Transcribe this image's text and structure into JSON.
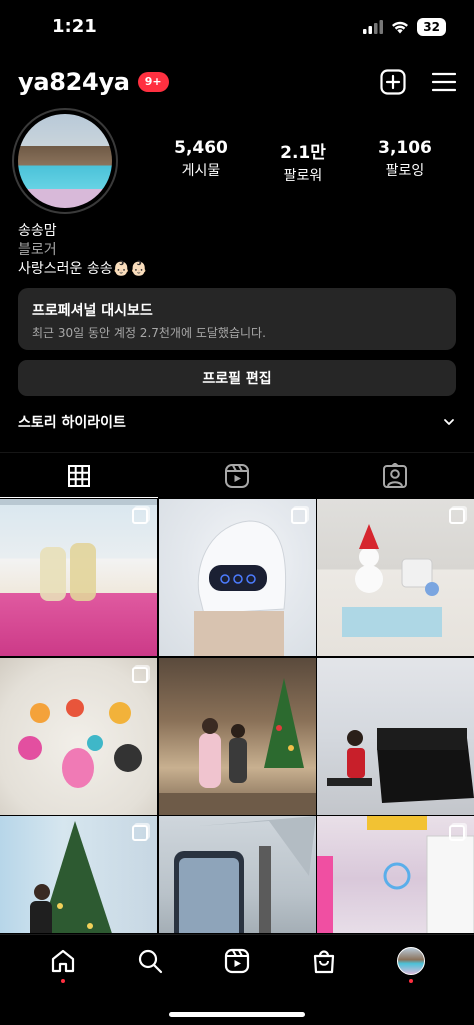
{
  "status_bar": {
    "time": "1:21",
    "battery": "32"
  },
  "header": {
    "username": "ya824ya",
    "notification_count": "9+"
  },
  "profile": {
    "stats": [
      {
        "value": "5,460",
        "label": "게시물"
      },
      {
        "value": "2.1만",
        "label": "팔로워"
      },
      {
        "value": "3,106",
        "label": "팔로잉"
      }
    ],
    "name": "송송맘",
    "category": "블로거",
    "bio": "사랑스러운 송송👶🏻👶🏻"
  },
  "dashboard": {
    "title": "프로페셔널 대시보드",
    "subtitle": "최근 30일 동안 계정 2.7천개에 도달했습니다."
  },
  "edit_profile_label": "프로필 편집",
  "highlights_label": "스토리 하이라이트",
  "tabs": [
    {
      "icon": "grid-icon",
      "active": true
    },
    {
      "icon": "reels-icon",
      "active": false
    },
    {
      "icon": "tagged-icon",
      "active": false
    }
  ],
  "grid": [
    {
      "multi": true
    },
    {
      "multi": true
    },
    {
      "multi": true
    },
    {
      "multi": true
    },
    {
      "multi": false
    },
    {
      "multi": false
    },
    {
      "multi": true
    },
    {
      "multi": false
    },
    {
      "multi": true
    }
  ],
  "bottom_nav": [
    "home-icon",
    "search-icon",
    "reels-icon",
    "shop-icon",
    "profile-avatar"
  ],
  "colors": {
    "background": "#000000",
    "card": "#262626",
    "badge": "#ff3040",
    "muted": "#a8a8a8"
  }
}
